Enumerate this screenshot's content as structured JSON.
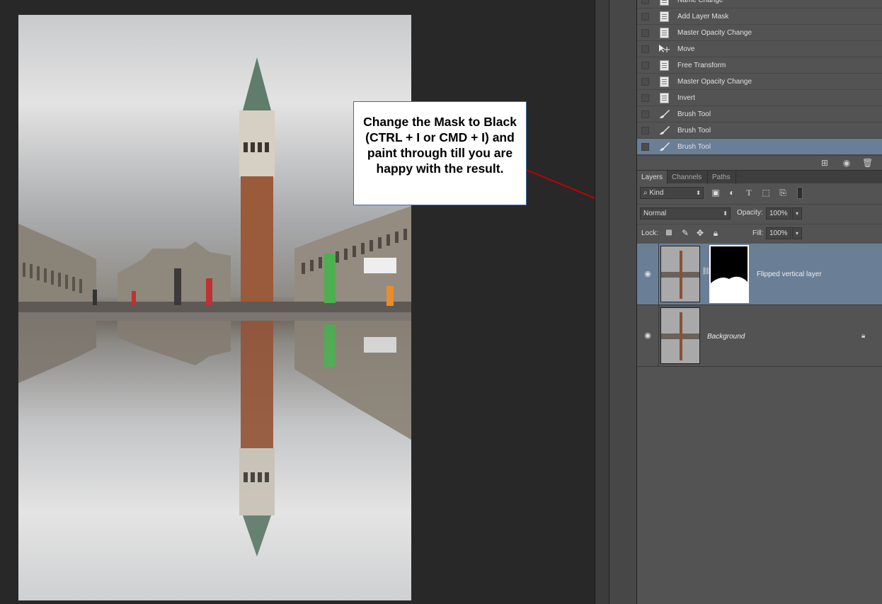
{
  "callout": {
    "text": "Change the Mask to Black (CTRL + I or CMD + I) and paint through till you are happy with the result."
  },
  "history": {
    "items": [
      {
        "label": "Name Change",
        "icon": "document-icon",
        "active": false
      },
      {
        "label": "Add Layer Mask",
        "icon": "document-icon",
        "active": false
      },
      {
        "label": "Master Opacity Change",
        "icon": "document-icon",
        "active": false
      },
      {
        "label": "Move",
        "icon": "move-tool-icon",
        "active": false
      },
      {
        "label": "Free Transform",
        "icon": "document-icon",
        "active": false
      },
      {
        "label": "Master Opacity Change",
        "icon": "document-icon",
        "active": false
      },
      {
        "label": "Invert",
        "icon": "document-icon",
        "active": false
      },
      {
        "label": "Brush Tool",
        "icon": "brush-icon",
        "active": false
      },
      {
        "label": "Brush Tool",
        "icon": "brush-icon",
        "active": false
      },
      {
        "label": "Brush Tool",
        "icon": "brush-icon",
        "active": true
      }
    ]
  },
  "tabs": [
    "Layers",
    "Channels",
    "Paths"
  ],
  "filter": {
    "kind_label": "Kind"
  },
  "blend": {
    "mode": "Normal",
    "opacity_label": "Opacity:",
    "opacity_value": "100%"
  },
  "lock": {
    "label": "Lock:",
    "fill_label": "Fill:",
    "fill_value": "100%"
  },
  "layers": [
    {
      "name": "Flipped vertical layer",
      "selected": true,
      "has_mask": true
    },
    {
      "name": "Background",
      "selected": false,
      "locked": true
    }
  ],
  "colors": {
    "selection": "#6a7e96",
    "panel": "#535353",
    "arrow": "#c00000",
    "callout_border": "#3a6ea5"
  }
}
